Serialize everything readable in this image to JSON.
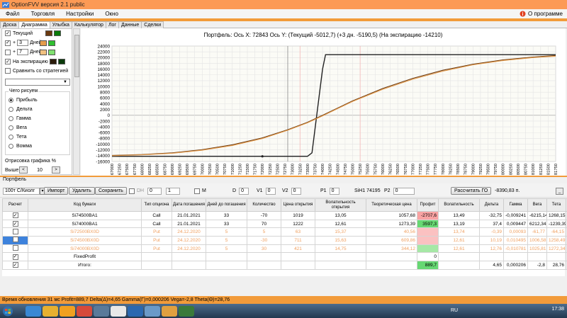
{
  "window": {
    "title": "OptionFVV версия 2.1 public"
  },
  "menu": {
    "items": [
      "Файл",
      "Торговля",
      "Настройки",
      "Окно"
    ],
    "about": "О программе"
  },
  "tabs": [
    "Доска",
    "Диаграмма",
    "Улыбка",
    "Калькулятор",
    "Лог",
    "Данные",
    "Сделки"
  ],
  "left": {
    "current": "Текущий",
    "plus": "+",
    "days1": "3",
    "days2": "7",
    "days_label": "Дней",
    "expiry": "На экспирацию",
    "compare": "Сравнить со стратегией",
    "what_title": "Чего рисуем",
    "options": [
      "Прибыль",
      "Дельта",
      "Гамма",
      "Вега",
      "Тета",
      "Вомма"
    ],
    "draw_title": "Отрисовка графика %",
    "higher": "Выше",
    "draw_value": "10",
    "colors": {
      "current": "#6b3a10",
      "current2": "#0a7a0a",
      "d3": "#e59b4b",
      "d3b": "#30c030",
      "d7": "#f0c080",
      "d7b": "#80e070",
      "exp": "#2a1a0a",
      "expb": "#0a3a0a"
    }
  },
  "chart_data": {
    "type": "line",
    "title": "Портфель: Ось X: 72843 Ось Y: (Текущий -5012,7) (+3 дн. -5190,5) (На экспирацию -14210)",
    "x_ticks": [
      "67000",
      "67250",
      "67500",
      "67750",
      "68000",
      "68250",
      "68500",
      "68750",
      "69000",
      "69250",
      "69500",
      "69750",
      "70000",
      "70250",
      "70500",
      "70750",
      "71000",
      "71250",
      "71500",
      "71750",
      "72000",
      "72250",
      "72500",
      "72750",
      "73000",
      "73250",
      "73500",
      "73750",
      "74000",
      "74250",
      "74500",
      "74750",
      "75000",
      "75250",
      "75500",
      "75750",
      "76000",
      "76250",
      "76500",
      "76750",
      "77000",
      "77250",
      "77500",
      "77750",
      "78000",
      "78250",
      "78500",
      "78750",
      "79000",
      "79250",
      "79500",
      "79750",
      "80000",
      "80250",
      "80500",
      "80750",
      "81000",
      "81250",
      "81500",
      "81750"
    ],
    "y_ticks": [
      "24000",
      "22000",
      "20000",
      "18000",
      "16000",
      "14000",
      "12000",
      "10000",
      "8000",
      "6000",
      "4000",
      "2000",
      "0",
      "-2000",
      "-4000",
      "-6000",
      "-8000",
      "-10000",
      "-12000",
      "-14000",
      "-16000"
    ],
    "xlim": [
      67000,
      81750
    ],
    "ylim": [
      -16000,
      24000
    ],
    "series": [
      {
        "color": "#222222",
        "x": [
          67000,
          72000,
          73500,
          73650,
          74000,
          74100,
          81750
        ],
        "y": [
          -14210,
          -14210,
          -14210,
          -13000,
          16000,
          21000,
          21000
        ]
      },
      {
        "color": "#6b3a10",
        "x": [
          67000,
          68000,
          69000,
          70000,
          71000,
          72000,
          72843,
          73500,
          74000,
          74500,
          75000,
          76000,
          77000,
          78000,
          79000,
          80000,
          81000,
          81750
        ],
        "y": [
          -13900,
          -13600,
          -13000,
          -11900,
          -10200,
          -7800,
          -5013,
          -2400,
          0,
          2500,
          5000,
          9300,
          12800,
          15600,
          17700,
          19200,
          20200,
          20700
        ]
      },
      {
        "color": "#e59b4b",
        "x": [
          67000,
          68000,
          69000,
          70000,
          71000,
          72000,
          72843,
          73500,
          74000,
          74500,
          75000,
          76000,
          77000,
          78000,
          79000,
          80000,
          81000,
          81750
        ],
        "y": [
          -14000,
          -13700,
          -13150,
          -12100,
          -10450,
          -8050,
          -5190,
          -2600,
          -200,
          2300,
          4800,
          9000,
          12500,
          15300,
          17500,
          19000,
          20000,
          20500
        ]
      }
    ],
    "cursor_x": 72843,
    "expiry_markers": [
      73250,
      75250
    ]
  },
  "portfolio": {
    "label": "Портфель",
    "account": "100т C/Киолг",
    "import": "Импорт",
    "delete": "Удалить",
    "save": "Сохранить",
    "dh": "DH",
    "spin0": "0",
    "spin1": "1",
    "m": "M",
    "d_label": "D",
    "d_val": "0",
    "v1_label": "V1",
    "v1_val": "0",
    "v2_label": "V2",
    "v2_val": "0",
    "p1_label": "P1",
    "p1_val": "0",
    "sih": "SiH1 74195",
    "p2_label": "P2",
    "p2_val": "0",
    "calc_go": "Рассчитать ГО",
    "go_value": "-8390,83 п.",
    "minimize": "_"
  },
  "table": {
    "headers": [
      "Расчет",
      "Код бумаги",
      "Тип опциона",
      "Дата погашения",
      "Дней до погашения",
      "Количество",
      "Цена открытия",
      "Волатильность открытия",
      "Теоретическая цена",
      "Профит",
      "Волатильность",
      "Дельта",
      "Гамма",
      "Вега",
      "Тета",
      "X"
    ],
    "rows": [
      {
        "checked": "✓",
        "code": "Si74500BA1",
        "type": "Call",
        "date": "21.01.2021",
        "days": "33",
        "qty": "-70",
        "price": "1019",
        "vol_open": "13,05",
        "theor": "1057,68",
        "profit": "-2707,6",
        "vol": "13,49",
        "delta": "-32,75",
        "gamma": "-0,009241",
        "vega": "-6215,14",
        "theta": "1268,15",
        "dim": false,
        "sign": "neg"
      },
      {
        "checked": "✓",
        "code": "Si74000BA1",
        "type": "Call",
        "date": "21.01.2021",
        "days": "33",
        "qty": "70",
        "price": "1222",
        "vol_open": "12,61",
        "theor": "1273,39",
        "profit": "3597,3",
        "vol": "13,19",
        "delta": "37,4",
        "gamma": "0,009447",
        "vega": "6212,34",
        "theta": "-1239,39",
        "dim": false,
        "sign": "pos"
      },
      {
        "checked": "",
        "code": "Si72500BX0D",
        "type": "Put",
        "date": "24.12.2020",
        "days": "5",
        "qty": "5",
        "price": "63",
        "vol_open": "15,37",
        "theor": "40,56",
        "profit": "",
        "vol": "13,74",
        "delta": "-0,39",
        "gamma": "0,00093",
        "vega": "-61,77",
        "theta": "-64,15",
        "dim": true,
        "sign": "neg"
      },
      {
        "checked": "",
        "code": "Si74500BX0D",
        "type": "Put",
        "date": "24.12.2020",
        "days": "5",
        "qty": "-30",
        "price": "711",
        "vol_open": "15,63",
        "theor": "609,86",
        "profit": "",
        "vol": "12,61",
        "delta": "10,19",
        "gamma": "0,010495",
        "vega": "1006,58",
        "theta": "1258,49",
        "dim": true,
        "sign": "neg"
      },
      {
        "checked": "",
        "code": "Si74000BX0D",
        "type": "Put",
        "date": "24.12.2020",
        "days": "5",
        "qty": "30",
        "price": "421",
        "vol_open": "14,75",
        "theor": "344,12",
        "profit": "",
        "vol": "12,61",
        "delta": "12,76",
        "gamma": "-0,010781",
        "vega": "1025,81",
        "theta": "1272,34",
        "dim": true,
        "sign": "pos"
      },
      {
        "checked": "✓",
        "code": "FixedProfit",
        "type": "",
        "date": "",
        "days": "",
        "qty": "",
        "price": "",
        "vol_open": "",
        "theor": "",
        "profit": "0",
        "vol": "",
        "delta": "",
        "gamma": "",
        "vega": "",
        "theta": "",
        "dim": false,
        "sign": ""
      },
      {
        "checked": "✓",
        "code": "Итого:",
        "type": "",
        "date": "",
        "days": "",
        "qty": "",
        "price": "",
        "vol_open": "",
        "theor": "",
        "profit": "889,7",
        "vol": "",
        "delta": "4,65",
        "gamma": "0,000206",
        "vega": "-2,8",
        "theta": "28,76",
        "dim": false,
        "sign": "pos"
      }
    ],
    "x_label": "X"
  },
  "status": {
    "text": "Время обновления 31 мс   Profit=889,7 Delta(Δ)=4,65 Gamma(Γ)=0,000206 Vega=-2,8 Theta(Θ)=28,76"
  },
  "taskbar": {
    "lang": "RU",
    "time": "17:38"
  }
}
